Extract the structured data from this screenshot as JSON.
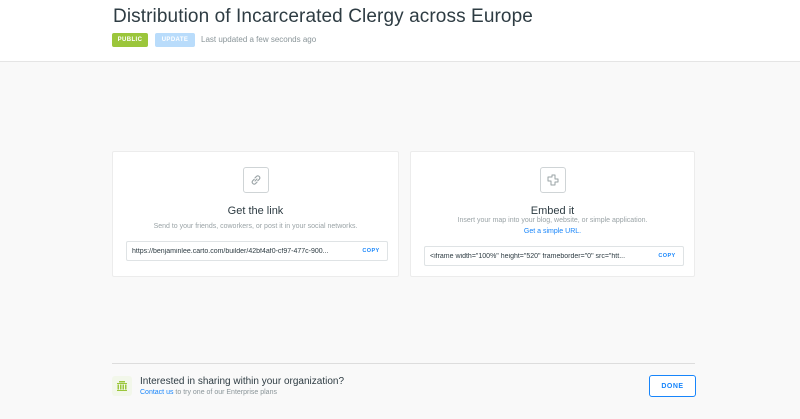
{
  "header": {
    "title": "Distribution of Incarcerated Clergy across Europe",
    "privacy_badge": "PUBLIC",
    "update_button": "UPDATE",
    "last_updated": "Last updated a few seconds ago"
  },
  "link_card": {
    "icon": "link-icon",
    "title": "Get the link",
    "description": "Send to your friends, coworkers, or post it in your social networks.",
    "url": "https://benjaminlee.carto.com/builder/42bf4af0-cf97-477c-900...",
    "copy_label": "COPY"
  },
  "embed_card": {
    "icon": "embed-icon",
    "title": "Embed it",
    "description": "Insert your map into your blog, website, or simple application.",
    "simple_url_link": "Get a simple URL.",
    "code": "<iframe width=\"100%\" height=\"520\" frameborder=\"0\" src=\"htt...",
    "copy_label": "COPY"
  },
  "footer": {
    "icon": "organization-icon",
    "title": "Interested in sharing within your organization?",
    "contact_link": "Contact us",
    "contact_rest": " to try one of our Enterprise plans",
    "done_label": "DONE"
  },
  "colors": {
    "accent_blue": "#1785fb",
    "public_green": "#9bc63b",
    "update_disabled": "#b9dcfb"
  }
}
